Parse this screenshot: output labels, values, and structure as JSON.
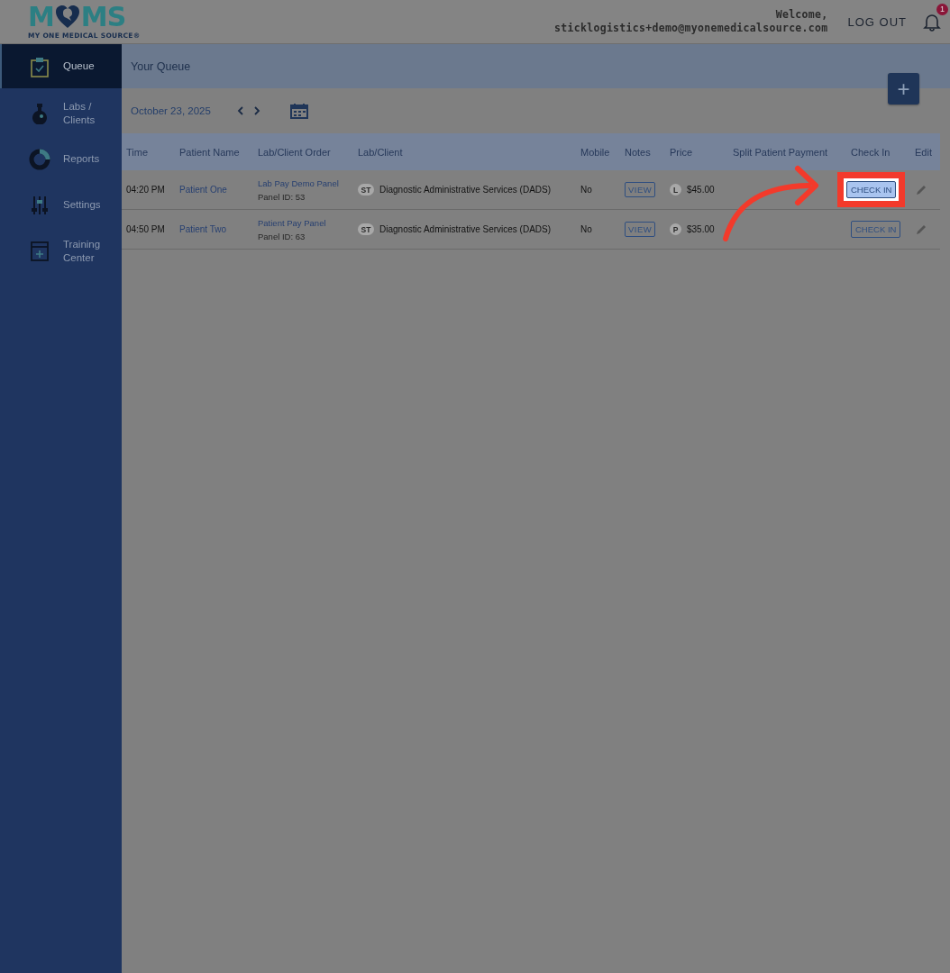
{
  "logo": {
    "letters_left": "M",
    "letters_right": "MS",
    "tagline": "MY ONE MEDICAL SOURCE®"
  },
  "header": {
    "welcome": "Welcome,",
    "email": "sticklogistics+demo@myonemedicalsource.com",
    "logout": "LOG OUT",
    "notification_count": "1"
  },
  "sidebar": {
    "items": [
      {
        "label": "Queue",
        "selected": true
      },
      {
        "label": "Labs / Clients",
        "selected": false
      },
      {
        "label": "Reports",
        "selected": false
      },
      {
        "label": "Settings",
        "selected": false
      },
      {
        "label": "Training Center",
        "selected": false
      }
    ]
  },
  "page": {
    "title": "Your Queue",
    "date": "October 23, 2025",
    "add_button": "+"
  },
  "table": {
    "columns": [
      "Time",
      "Patient Name",
      "Lab/Client Order",
      "Lab/Client",
      "Mobile",
      "Notes",
      "Price",
      "Split Patient Payment",
      "Check In",
      "Edit"
    ],
    "rows": [
      {
        "time": "04:20 PM",
        "patient": "Patient One",
        "order": "Lab Pay Demo Panel",
        "panel_id": "Panel ID: 53",
        "client_badge": "ST",
        "client": "Diagnostic Administrative Services (DADS)",
        "mobile": "No",
        "notes": "VIEW",
        "price_badge": "L",
        "price": "$45.00",
        "check_in": "CHECK IN",
        "highlighted": true
      },
      {
        "time": "04:50 PM",
        "patient": "Patient Two",
        "order": "Patient Pay Panel",
        "panel_id": "Panel ID: 63",
        "client_badge": "ST",
        "client": "Diagnostic Administrative Services (DADS)",
        "mobile": "No",
        "notes": "VIEW",
        "price_badge": "P",
        "price": "$35.00",
        "check_in": "CHECK IN",
        "highlighted": false
      }
    ]
  },
  "annotation": {
    "kind": "arrow"
  }
}
